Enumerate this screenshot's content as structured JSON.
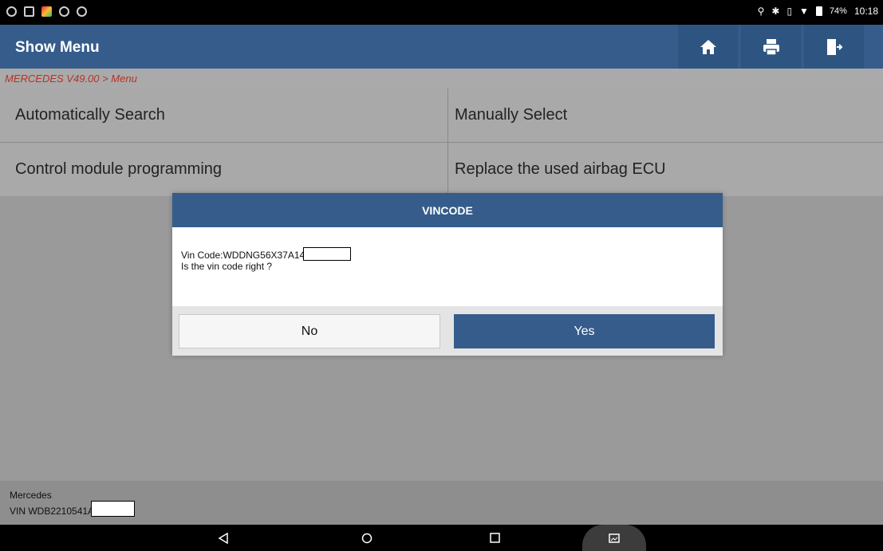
{
  "status_bar": {
    "battery": "74%",
    "time": "10:18",
    "left_icons": [
      "alarm-icon",
      "gallery-icon",
      "app-icon",
      "sync-icon",
      "search-icon"
    ],
    "right_icons": [
      "location-icon",
      "bluetooth-icon",
      "vibrate-icon",
      "wifi-icon",
      "battery-icon"
    ]
  },
  "header": {
    "title": "Show Menu",
    "buttons": [
      "home-icon",
      "print-icon",
      "exit-icon"
    ]
  },
  "breadcrumb": "MERCEDES V49.00 > Menu",
  "menu": {
    "items": [
      {
        "label": "Automatically Search"
      },
      {
        "label": "Manually Select"
      },
      {
        "label": "Control module programming"
      },
      {
        "label": "Replace the used airbag ECU"
      }
    ]
  },
  "dialog": {
    "title": "VINCODE",
    "vin_line": "Vin Code:WDDNG56X37A14",
    "question": "Is the vin code right ?",
    "no_label": "No",
    "yes_label": "Yes"
  },
  "footer": {
    "make": "Mercedes",
    "vin": "VIN WDB2210541A"
  },
  "nav": {
    "buttons": [
      "back-icon",
      "home-circle-icon",
      "recents-icon",
      "screenshot-icon"
    ]
  },
  "colors": {
    "header_blue": "#355c8b",
    "breadcrumb_red": "#b5322a",
    "background_gray": "#9a9a9a"
  }
}
